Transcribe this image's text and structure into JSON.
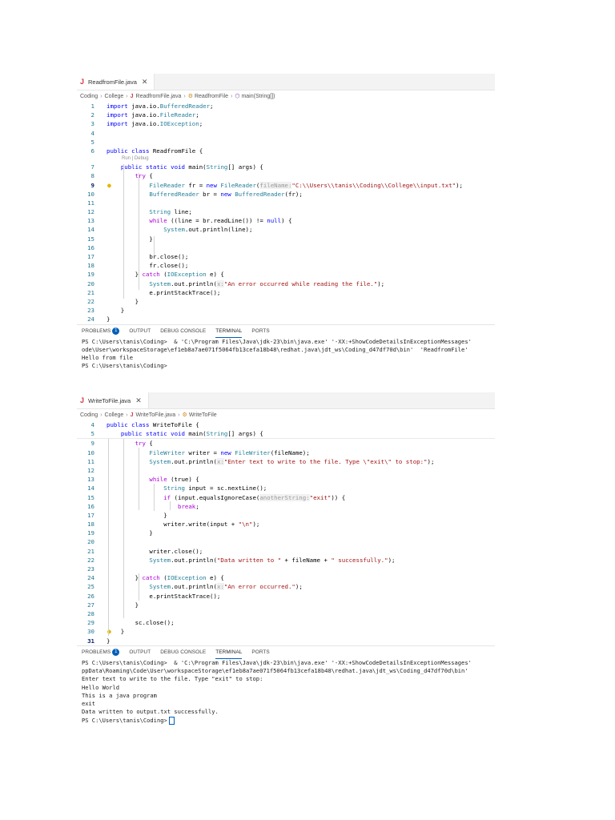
{
  "shot1": {
    "tab_label": "ReadfromFile.java",
    "breadcrumb": [
      "Coding",
      "College",
      "ReadfromFile.java",
      "ReadfromFile",
      "main(String[])"
    ],
    "codelens": "Run | Debug",
    "lines": [
      {
        "n": "1",
        "t": "import java.io.BufferedReader;"
      },
      {
        "n": "2",
        "t": "import java.io.FileReader;"
      },
      {
        "n": "3",
        "t": "import java.io.IOException;"
      },
      {
        "n": "4",
        "t": ""
      },
      {
        "n": "5",
        "t": ""
      },
      {
        "n": "6",
        "t": "public class ReadfromFile {"
      },
      {
        "n": "7",
        "t": "    public static void main(String[] args) {"
      },
      {
        "n": "8",
        "t": "        try {"
      },
      {
        "n": "9",
        "t": "            FileReader fr = new FileReader(fileName:\"C:\\\\Users\\\\tanis\\\\Coding\\\\College\\\\input.txt\");"
      },
      {
        "n": "10",
        "t": "            BufferedReader br = new BufferedReader(fr);"
      },
      {
        "n": "11",
        "t": ""
      },
      {
        "n": "12",
        "t": "            String line;"
      },
      {
        "n": "13",
        "t": "            while ((line = br.readLine()) != null) {"
      },
      {
        "n": "14",
        "t": "                System.out.println(line);"
      },
      {
        "n": "15",
        "t": "            }"
      },
      {
        "n": "16",
        "t": ""
      },
      {
        "n": "17",
        "t": "            br.close();"
      },
      {
        "n": "18",
        "t": "            fr.close();"
      },
      {
        "n": "19",
        "t": "        } catch (IOException e) {"
      },
      {
        "n": "20",
        "t": "            System.out.println(x:\"An error occurred while reading the file.\");"
      },
      {
        "n": "21",
        "t": "            e.printStackTrace();"
      },
      {
        "n": "22",
        "t": "        }"
      },
      {
        "n": "23",
        "t": "    }"
      },
      {
        "n": "24",
        "t": "}"
      }
    ],
    "panel_tabs": [
      "PROBLEMS",
      "OUTPUT",
      "DEBUG CONSOLE",
      "TERMINAL",
      "PORTS"
    ],
    "problems_count": "1",
    "terminal": [
      "PS C:\\Users\\tanis\\Coding>  & 'C:\\Program Files\\Java\\jdk-23\\bin\\java.exe' '-XX:+ShowCodeDetailsInExceptionMessages'",
      "ode\\User\\workspaceStorage\\ef1eb8a7ae071f5064fb13cefa18b48\\redhat.java\\jdt_ws\\Coding_d47df70d\\bin'  'ReadfromFile'",
      "Hello from file",
      "PS C:\\Users\\tanis\\Coding>"
    ]
  },
  "shot2": {
    "tab_label": "WriteToFile.java",
    "breadcrumb": [
      "Coding",
      "College",
      "WriteToFile.java",
      "WriteToFile"
    ],
    "sticky": [
      {
        "n": "4",
        "t": "public class WriteToFile {"
      },
      {
        "n": "5",
        "t": "    public static void main(String[] args) {"
      }
    ],
    "lines": [
      {
        "n": "9",
        "t": "        try {"
      },
      {
        "n": "10",
        "t": "            FileWriter writer = new FileWriter(fileName);"
      },
      {
        "n": "11",
        "t": "            System.out.println(x:\"Enter text to write to the file. Type \\\"exit\\\" to stop:\");"
      },
      {
        "n": "12",
        "t": ""
      },
      {
        "n": "13",
        "t": "            while (true) {"
      },
      {
        "n": "14",
        "t": "                String input = sc.nextLine();"
      },
      {
        "n": "15",
        "t": "                if (input.equalsIgnoreCase(anotherString:\"exit\")) {"
      },
      {
        "n": "16",
        "t": "                    break;"
      },
      {
        "n": "17",
        "t": "                }"
      },
      {
        "n": "18",
        "t": "                writer.write(input + \"\\n\");"
      },
      {
        "n": "19",
        "t": "            }"
      },
      {
        "n": "20",
        "t": ""
      },
      {
        "n": "21",
        "t": "            writer.close();"
      },
      {
        "n": "22",
        "t": "            System.out.println(\"Data written to \" + fileName + \" successfully.\");"
      },
      {
        "n": "23",
        "t": ""
      },
      {
        "n": "24",
        "t": "        } catch (IOException e) {"
      },
      {
        "n": "25",
        "t": "            System.out.println(x:\"An error occurred.\");"
      },
      {
        "n": "26",
        "t": "            e.printStackTrace();"
      },
      {
        "n": "27",
        "t": "        }"
      },
      {
        "n": "28",
        "t": ""
      },
      {
        "n": "29",
        "t": "        sc.close();"
      },
      {
        "n": "30",
        "t": "    }"
      },
      {
        "n": "31",
        "t": "}"
      }
    ],
    "panel_tabs": [
      "PROBLEMS",
      "OUTPUT",
      "DEBUG CONSOLE",
      "TERMINAL",
      "PORTS"
    ],
    "problems_count": "1",
    "terminal": [
      "PS C:\\Users\\tanis\\Coding>  & 'C:\\Program Files\\Java\\jdk-23\\bin\\java.exe' '-XX:+ShowCodeDetailsInExceptionMessages'",
      "ppData\\Roaming\\Code\\User\\workspaceStorage\\ef1eb8a7ae071f5064fb13cefa18b48\\redhat.java\\jdt_ws\\Coding_d47df70d\\bin'",
      "Enter text to write to the file. Type \"exit\" to stop:",
      "Hello World",
      "This is a java program",
      "exit",
      "Data written to output.txt successfully.",
      "PS C:\\Users\\tanis\\Coding>"
    ]
  },
  "colors": {
    "keyword": "#0000ff",
    "control": "#af00db",
    "type": "#267f99",
    "string": "#a31515",
    "line_number": "#237893",
    "accent": "#005fb8"
  },
  "icons": [
    "java-file-icon",
    "close-icon",
    "chevron-right-icon",
    "class-icon",
    "method-icon",
    "lightbulb-icon"
  ]
}
